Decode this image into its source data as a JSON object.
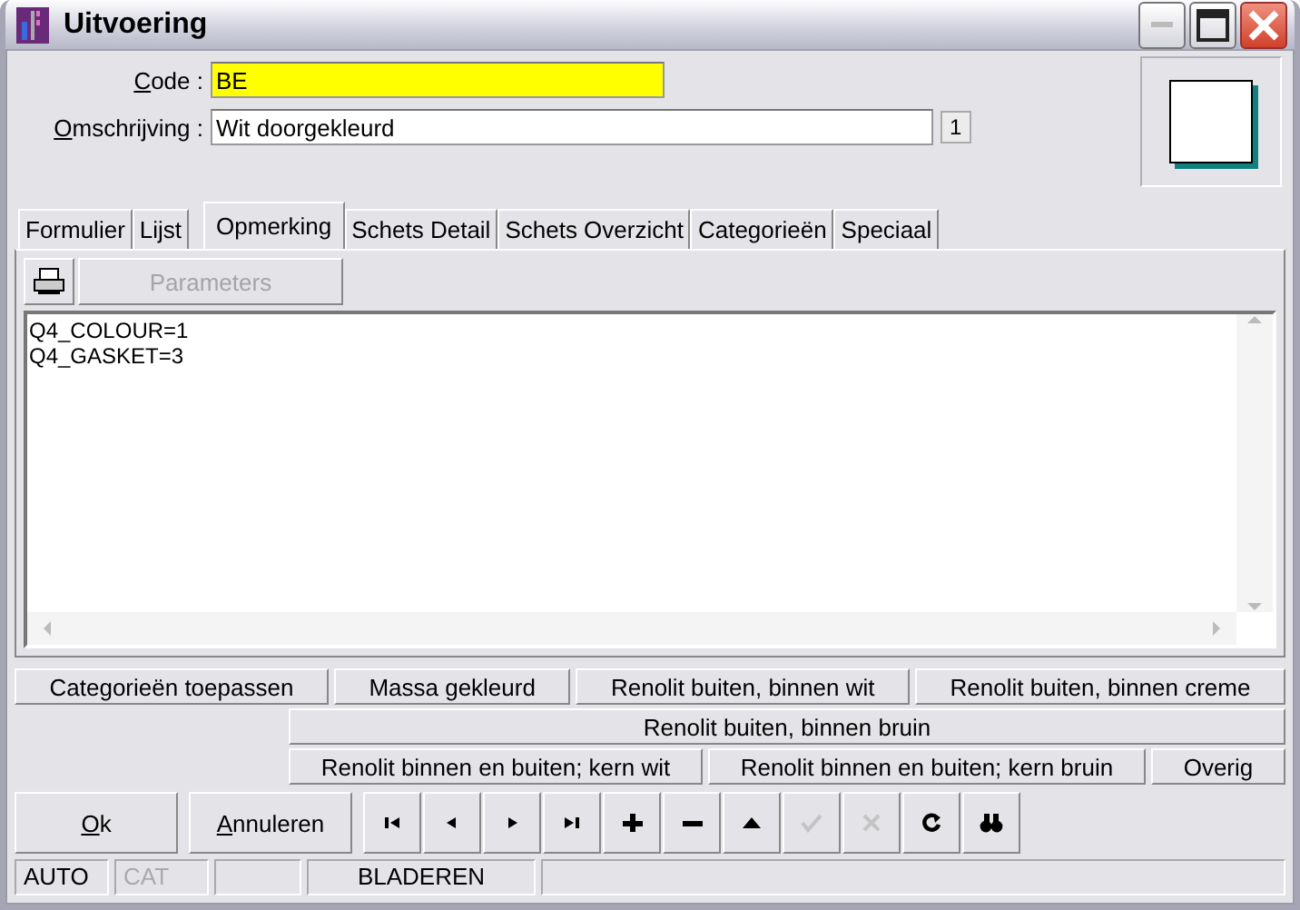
{
  "window": {
    "title": "Uitvoering"
  },
  "fields": [
    {
      "key": "C",
      "rest": "ode :",
      "value": "BE",
      "kind": "highlight"
    },
    {
      "key": "O",
      "rest": "mschrijving :",
      "value": "Wit doorgekleurd",
      "kind": "plain",
      "counter": "1"
    }
  ],
  "tabs": [
    {
      "label": "Formulier",
      "selected": false
    },
    {
      "label": "Lijst",
      "selected": false
    },
    {
      "label": "Opmerking",
      "selected": true
    },
    {
      "label": "Schets Detail",
      "selected": false
    },
    {
      "label": "Schets Overzicht",
      "selected": false
    },
    {
      "label": "Categorieën",
      "selected": false
    },
    {
      "label": "Speciaal",
      "selected": false
    }
  ],
  "toolbar": {
    "parameters": {
      "label": "Parameters",
      "disabled": true
    }
  },
  "memo_lines": [
    "Q4_COLOUR=1",
    "Q4_GASKET=3"
  ],
  "category_rows": [
    [
      {
        "label": "Categorieën toepassen"
      },
      {
        "label": "Massa gekleurd"
      },
      {
        "label": "Renolit buiten, binnen wit"
      },
      {
        "label": "Renolit buiten, binnen creme"
      }
    ],
    [
      {
        "label": "Renolit buiten, binnen bruin"
      }
    ],
    [
      {
        "label": "Renolit binnen en buiten; kern wit"
      },
      {
        "label": "Renolit binnen en buiten; kern bruin"
      },
      {
        "label": "Overig"
      }
    ]
  ],
  "actions": [
    {
      "key": "O",
      "rest": "k"
    },
    {
      "key": "A",
      "rest": "nnuleren"
    }
  ],
  "nav": [
    {
      "kind": "first",
      "disabled": false
    },
    {
      "kind": "prev",
      "disabled": false
    },
    {
      "kind": "next",
      "disabled": false
    },
    {
      "kind": "last",
      "disabled": false
    },
    {
      "kind": "add",
      "disabled": false
    },
    {
      "kind": "delete",
      "disabled": false
    },
    {
      "kind": "up",
      "disabled": false
    },
    {
      "kind": "confirm",
      "disabled": true
    },
    {
      "kind": "cancel",
      "disabled": true
    },
    {
      "kind": "refresh",
      "disabled": false
    },
    {
      "kind": "find",
      "disabled": false
    }
  ],
  "status_bar": [
    {
      "text": "AUTO",
      "disabled": false
    },
    {
      "text": "CAT",
      "disabled": true
    },
    {
      "text": "BLADEREN",
      "disabled": false
    }
  ]
}
